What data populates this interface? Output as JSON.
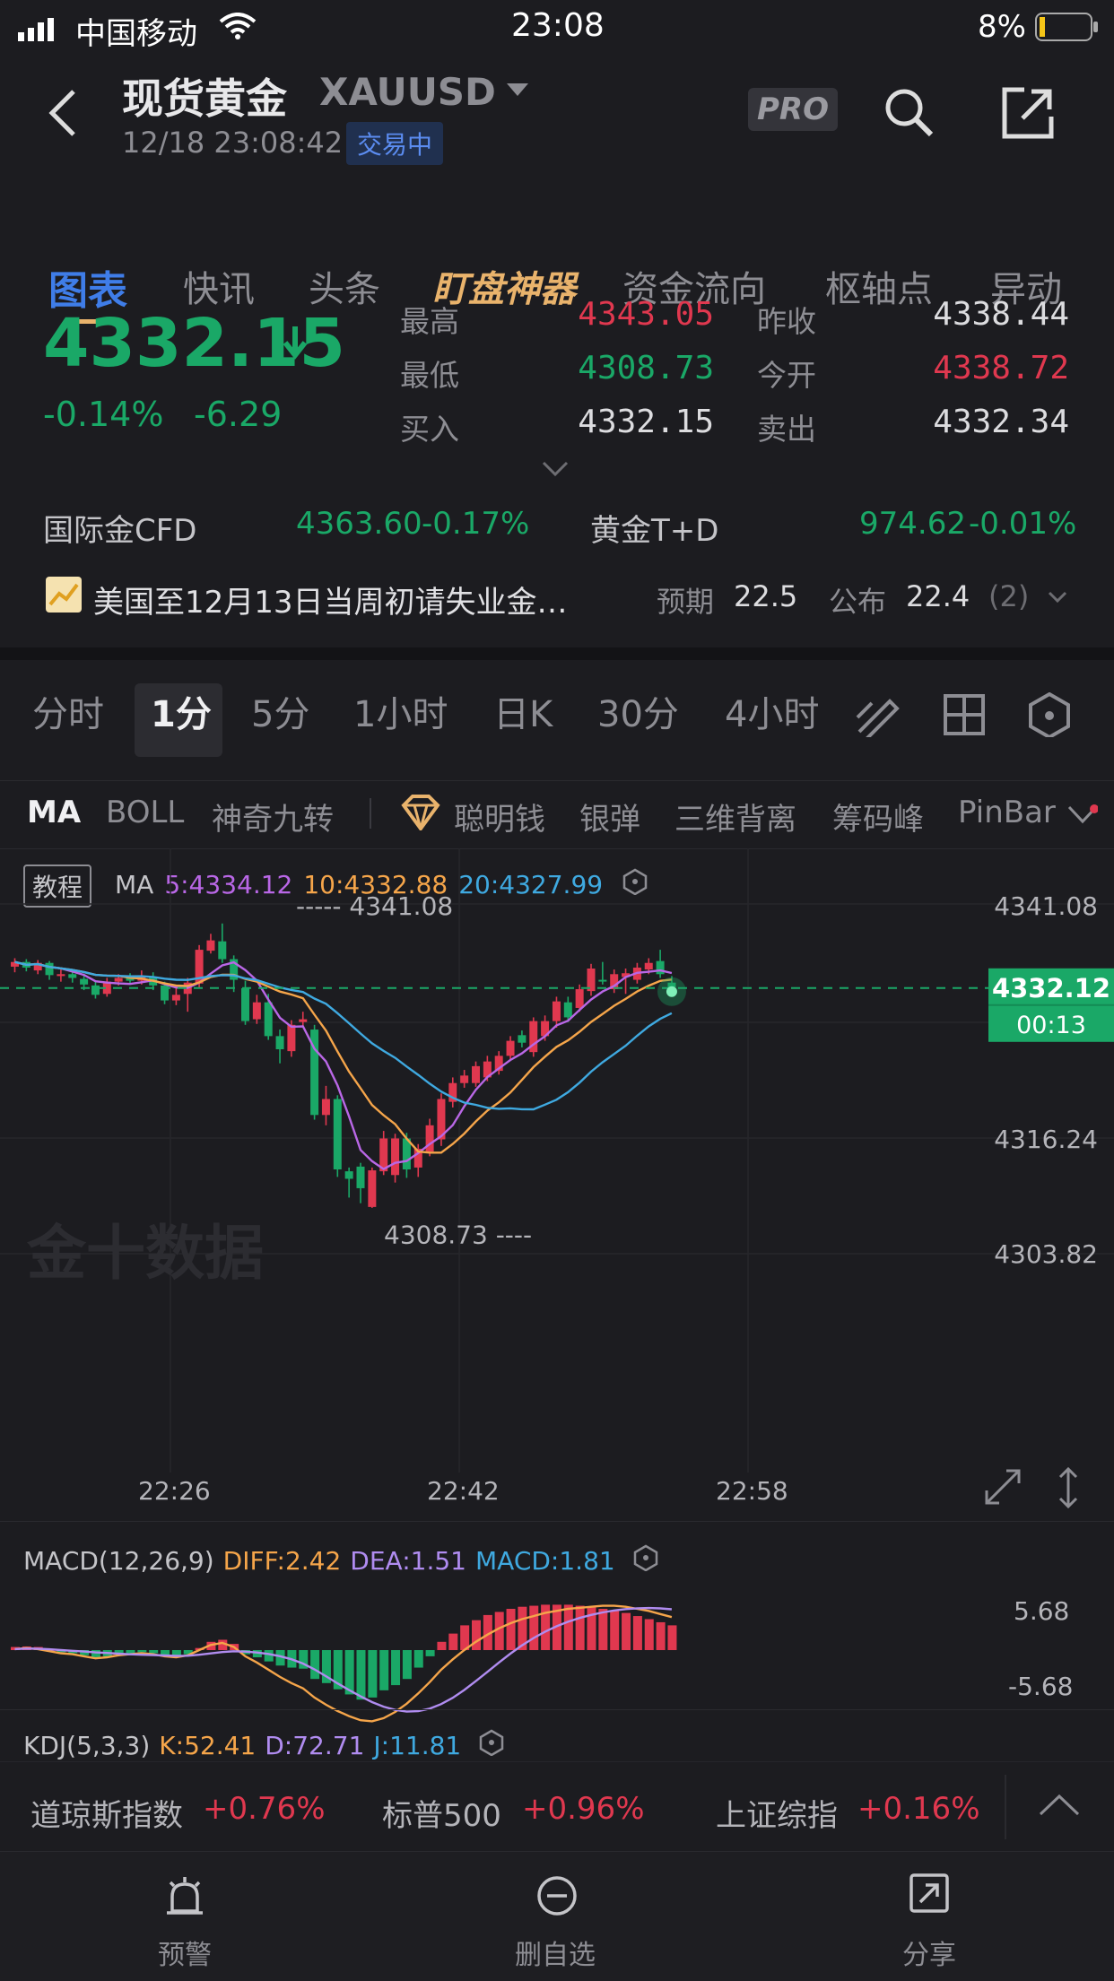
{
  "status_bar": {
    "carrier": "中国移动",
    "time": "23:08",
    "battery": "8%"
  },
  "header": {
    "title": "现货黄金",
    "symbol": "XAUUSD",
    "datetime": "12/18 23:08:42",
    "market_status": "交易中",
    "pro_label": "PRO"
  },
  "tabs": [
    "图表",
    "快讯",
    "头条",
    "盯盘神器",
    "资金流向",
    "枢轴点",
    "异动"
  ],
  "quote": {
    "price": "4332.15",
    "change_pct": "-0.14%",
    "change": "-6.29",
    "high_label": "最高",
    "high": "4343.05",
    "low_label": "最低",
    "low": "4308.73",
    "bid_label": "买入",
    "bid": "4332.15",
    "prev_close_label": "昨收",
    "prev_close": "4338.44",
    "open_label": "今开",
    "open": "4338.72",
    "ask_label": "卖出",
    "ask": "4332.34"
  },
  "related": {
    "cfd_label": "国际金CFD",
    "cfd_price": "4363.60",
    "cfd_change": "-0.17%",
    "td_label": "黄金T+D",
    "td_price": "974.62",
    "td_change": "-0.01%"
  },
  "news": {
    "headline": "美国至12月13日当周初请失业金…",
    "forecast_label": "预期",
    "forecast": "22.5",
    "actual_label": "公布",
    "actual": "22.4",
    "count": "(2)"
  },
  "periods": [
    "分时",
    "1分",
    "5分",
    "1小时",
    "日K",
    "30分",
    "4小时"
  ],
  "indicators": [
    "MA",
    "BOLL",
    "神奇九转",
    "聪明钱",
    "银弹",
    "三维背离",
    "筹码峰",
    "PinBar"
  ],
  "ma_legend": {
    "tutorial": "教程",
    "label": "MA",
    "ma5": "5:4334.12",
    "ma10": "10:4332.88",
    "ma20": "20:4327.99"
  },
  "main_chart": {
    "y_labels": [
      "4341.08",
      "4316.24",
      "4303.82"
    ],
    "max_marker": "4341.08",
    "min_marker": "4308.73",
    "current_price": "4332.12",
    "countdown": "00:13",
    "x_labels": [
      "22:26",
      "22:42",
      "22:58"
    ],
    "watermark": "金十数据"
  },
  "macd": {
    "label": "MACD(12,26,9)",
    "diff": "DIFF:2.42",
    "dea": "DEA:1.51",
    "macd": "MACD:1.81",
    "y_top": "5.68",
    "y_bottom": "-5.68"
  },
  "kdj": {
    "label": "KDJ(5,3,3)",
    "k": "K:52.41",
    "d": "D:72.71",
    "j": "J:11.81"
  },
  "ticker": [
    {
      "name": "道琼斯指数",
      "change": "+0.76%"
    },
    {
      "name": "标普500",
      "change": "+0.96%"
    },
    {
      "name": "上证综指",
      "change": "+0.16%"
    }
  ],
  "bottom_nav": [
    "预警",
    "删自选",
    "分享"
  ],
  "colors": {
    "up": "#e0384f",
    "down": "#1aa867",
    "ma5": "#b967e6",
    "ma10": "#f5a54a",
    "ma20": "#3fa9e0",
    "accent": "#3f7de8",
    "gold": "#e9b36c"
  },
  "chart_data": {
    "type": "candlestick",
    "ylim": [
      4303.82,
      4341.08
    ],
    "x": [
      "22:26",
      "22:42",
      "22:58"
    ],
    "series": [
      {
        "name": "MA5"
      },
      {
        "name": "MA10"
      },
      {
        "name": "MA20"
      }
    ]
  }
}
